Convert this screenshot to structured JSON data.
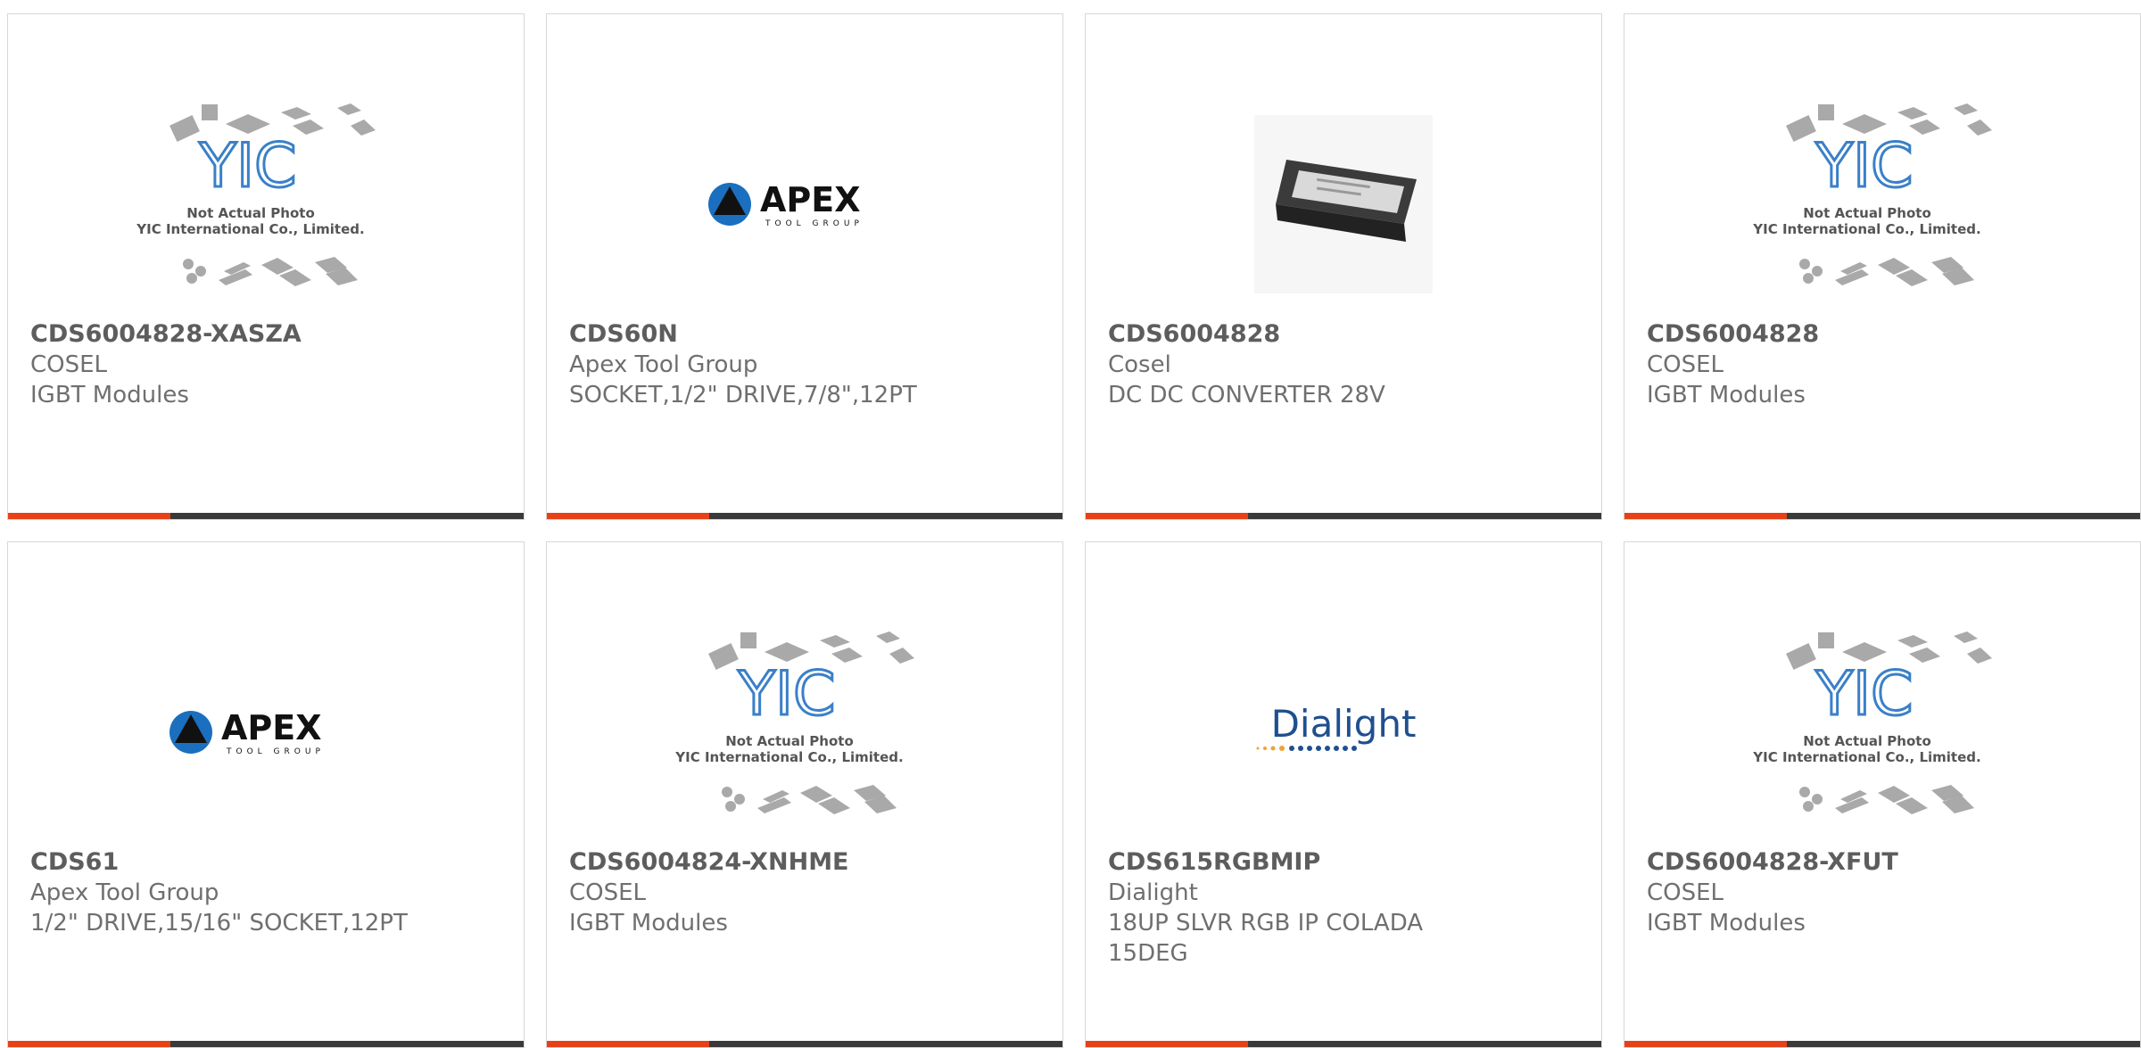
{
  "colors": {
    "accent": "#e84118",
    "bar": "#3a3a3a",
    "text": "#6f6f6f"
  },
  "placeholder": {
    "line1": "Not Actual Photo",
    "line2": "YIC International Co., Limited.",
    "logo": "YIC"
  },
  "apex": {
    "name": "APEX",
    "sub": "TOOL GROUP"
  },
  "dialight": {
    "name": "Dialight"
  },
  "products": [
    {
      "part": "CDS6004828-XASZA",
      "maker": "COSEL",
      "desc": "IGBT Modules",
      "image": "yic-placeholder"
    },
    {
      "part": "CDS60N",
      "maker": "Apex Tool Group",
      "desc": "SOCKET,1/2\" DRIVE,7/8\",12PT",
      "image": "apex-logo"
    },
    {
      "part": "CDS6004828",
      "maker": "Cosel",
      "desc": "DC DC CONVERTER 28V",
      "image": "converter-photo"
    },
    {
      "part": "CDS6004828",
      "maker": "COSEL",
      "desc": "IGBT Modules",
      "image": "yic-placeholder"
    },
    {
      "part": "CDS61",
      "maker": "Apex Tool Group",
      "desc": "1/2\" DRIVE,15/16\" SOCKET,12PT",
      "image": "apex-logo"
    },
    {
      "part": "CDS6004824-XNHME",
      "maker": "COSEL",
      "desc": "IGBT Modules",
      "image": "yic-placeholder"
    },
    {
      "part": "CDS615RGBMIP",
      "maker": "Dialight",
      "desc": "18UP SLVR RGB IP COLADA 15DEG",
      "image": "dialight-logo"
    },
    {
      "part": "CDS6004828-XFUT",
      "maker": "COSEL",
      "desc": "IGBT Modules",
      "image": "yic-placeholder"
    }
  ]
}
